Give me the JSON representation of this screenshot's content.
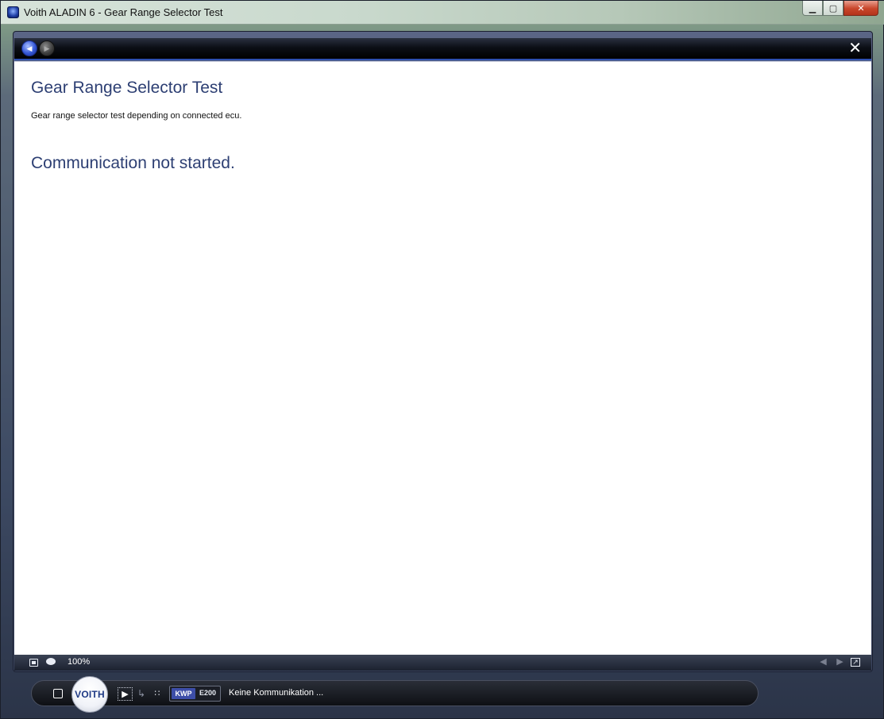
{
  "window": {
    "title": "Voith ALADIN 6 - Gear Range Selector Test",
    "minimize_glyph": "▁",
    "maximize_glyph": "▢",
    "close_glyph": "✕"
  },
  "toolbar": {
    "back_glyph": "◀",
    "forward_glyph": "▶",
    "close_glyph": "✕"
  },
  "content": {
    "title": "Gear Range Selector Test",
    "description": "Gear range selector test depending on connected ecu.",
    "status_message": "Communication not started."
  },
  "bottom_bar": {
    "zoom": "100%",
    "prev_glyph": "◀",
    "next_glyph": "▶",
    "popout_glyph": "↗"
  },
  "status_strip": {
    "logo_text": "VOITH",
    "play_glyph": "▶",
    "transfer_glyph": "↳",
    "grid_glyph": "∷",
    "protocol": "KWP",
    "ecu": "E200",
    "connection_status": "Keine Kommunikation ..."
  },
  "colors": {
    "title_text": "#2d3f73",
    "accent_blue": "#2d4fb0",
    "protocol_badge": "#3d4ea8"
  }
}
